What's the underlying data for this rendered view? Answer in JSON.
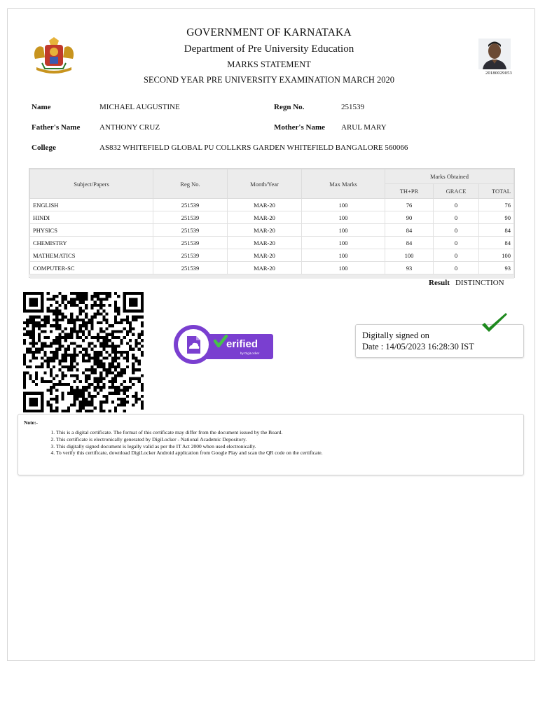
{
  "header": {
    "line1": "GOVERNMENT OF KARNATAKA",
    "line2": "Department of Pre University Education",
    "line3": "MARKS STATEMENT",
    "line4": "SECOND YEAR PRE UNIVERSITY EXAMINATION MARCH 2020"
  },
  "photo_id": "20180029053",
  "student": {
    "name_label": "Name",
    "name": "MICHAEL AUGUSTINE",
    "regn_label": "Regn No.",
    "regn": "251539",
    "father_label": "Father's Name",
    "father": "ANTHONY CRUZ",
    "mother_label": "Mother's Name",
    "mother": "ARUL MARY",
    "college_label": "College",
    "college": "AS832 WHITEFIELD GLOBAL PU COLLKRS GARDEN WHITEFIELD BANGALORE 560066"
  },
  "marks_table": {
    "headers": {
      "subject": "Subject/Papers",
      "reg": "Reg No.",
      "month": "Month/Year",
      "max": "Max Marks",
      "obtained": "Marks Obtained",
      "thpr": "TH+PR",
      "grace": "GRACE",
      "total": "TOTAL"
    },
    "rows": [
      {
        "subject": "ENGLISH",
        "reg": "251539",
        "month": "MAR-20",
        "max": "100",
        "thpr": "76",
        "grace": "0",
        "total": "76"
      },
      {
        "subject": "HINDI",
        "reg": "251539",
        "month": "MAR-20",
        "max": "100",
        "thpr": "90",
        "grace": "0",
        "total": "90"
      },
      {
        "subject": "PHYSICS",
        "reg": "251539",
        "month": "MAR-20",
        "max": "100",
        "thpr": "84",
        "grace": "0",
        "total": "84"
      },
      {
        "subject": "CHEMISTRY",
        "reg": "251539",
        "month": "MAR-20",
        "max": "100",
        "thpr": "84",
        "grace": "0",
        "total": "84"
      },
      {
        "subject": "MATHEMATICS",
        "reg": "251539",
        "month": "MAR-20",
        "max": "100",
        "thpr": "100",
        "grace": "0",
        "total": "100"
      },
      {
        "subject": "COMPUTER-SC",
        "reg": "251539",
        "month": "MAR-20",
        "max": "100",
        "thpr": "93",
        "grace": "0",
        "total": "93"
      }
    ]
  },
  "result": {
    "label": "Result",
    "value": "DISTINCTION"
  },
  "verified_badge": {
    "text": "erified",
    "subtext": "by DigiLocker"
  },
  "signature": {
    "line1": "Digitally signed on",
    "line2": "Date : 14/05/2023 16:28:30 IST"
  },
  "notes": {
    "title": "Note:-",
    "items": [
      "This is a digital certificate. The format of this certificate may differ from the document issued by the Board.",
      "This certificate is electronically generated by DigiLocker - National Academic Depository.",
      "This digitally signed document is legally valid as per the IT Act 2000 when used electronically.",
      "To verify this certificate, download DigiLocker Android application from Google Play and scan the QR code on the certificate."
    ]
  },
  "colors": {
    "badge_purple": "#7a3fd0",
    "tick_green": "#1f8a1f",
    "header_gray": "#ececec"
  }
}
